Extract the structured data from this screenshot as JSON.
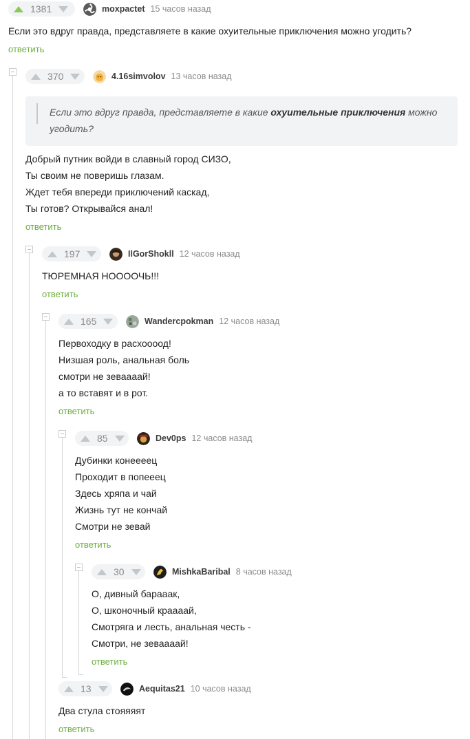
{
  "comments": [
    {
      "votes": "1381",
      "author": "moxpactet",
      "time": "15 часов назад",
      "lines": [
        "Если это вдруг правда, представляете в какие охуительные приключения можно угодить?"
      ],
      "reply": "ответить"
    },
    {
      "votes": "370",
      "author": "4.16simvolov",
      "time": "13 часов назад",
      "quote": {
        "line1_before": "Если это вдруг правда, представляете в какие ",
        "line1_bold": "охуительные приключения",
        "line1_after": " можно",
        "line2": "угодить?"
      },
      "lines": [
        "Добрый путник войди в славный город СИЗО,",
        "Ты своим не поверишь глазам.",
        "Ждет тебя впереди приключений каскад,",
        "Ты готов? Открывайся анал!"
      ],
      "reply": "ответить"
    },
    {
      "votes": "197",
      "author": "IlGorShokll",
      "time": "12 часов назад",
      "lines": [
        "ТЮРЕМНАЯ НООООЧЬ!!!"
      ],
      "reply": "ответить"
    },
    {
      "votes": "165",
      "author": "Wandercpokman",
      "time": "12 часов назад",
      "lines": [
        "Первоходку в расхоооод!",
        "Низшая роль, анальная боль",
        "смотри не зеваааай!",
        "а то вставят и в рот."
      ],
      "reply": "ответить"
    },
    {
      "votes": "85",
      "author": "Dev0ps",
      "time": "12 часов назад",
      "lines": [
        "Дубинки конеееец",
        "Проходит в попееец",
        "Здесь хряпа и чай",
        "Жизнь тут не кончай",
        "Смотри не зевай"
      ],
      "reply": "ответить"
    },
    {
      "votes": "30",
      "author": "MishkaBaribal",
      "time": "8 часов назад",
      "lines": [
        "О, дивный барааак,",
        "О, шконочный краааай,",
        "Смотряга и лесть, анальная честь -",
        "Смотри, не зеваааай!"
      ],
      "reply": "ответить"
    },
    {
      "votes": "13",
      "author": "Aequitas21",
      "time": "10 часов назад",
      "lines": [
        "Два стула стояяяят"
      ],
      "reply": "ответить"
    }
  ],
  "colors": {
    "accent_green": "#6aae3e",
    "upvote_green": "#8ac858",
    "meta_grey": "#8a8a8a",
    "quote_bg": "#f2f3f5"
  },
  "icons": {
    "upvote": "triangle-up-icon",
    "downvote": "triangle-down-icon",
    "collapse": "collapse-minus-icon"
  }
}
